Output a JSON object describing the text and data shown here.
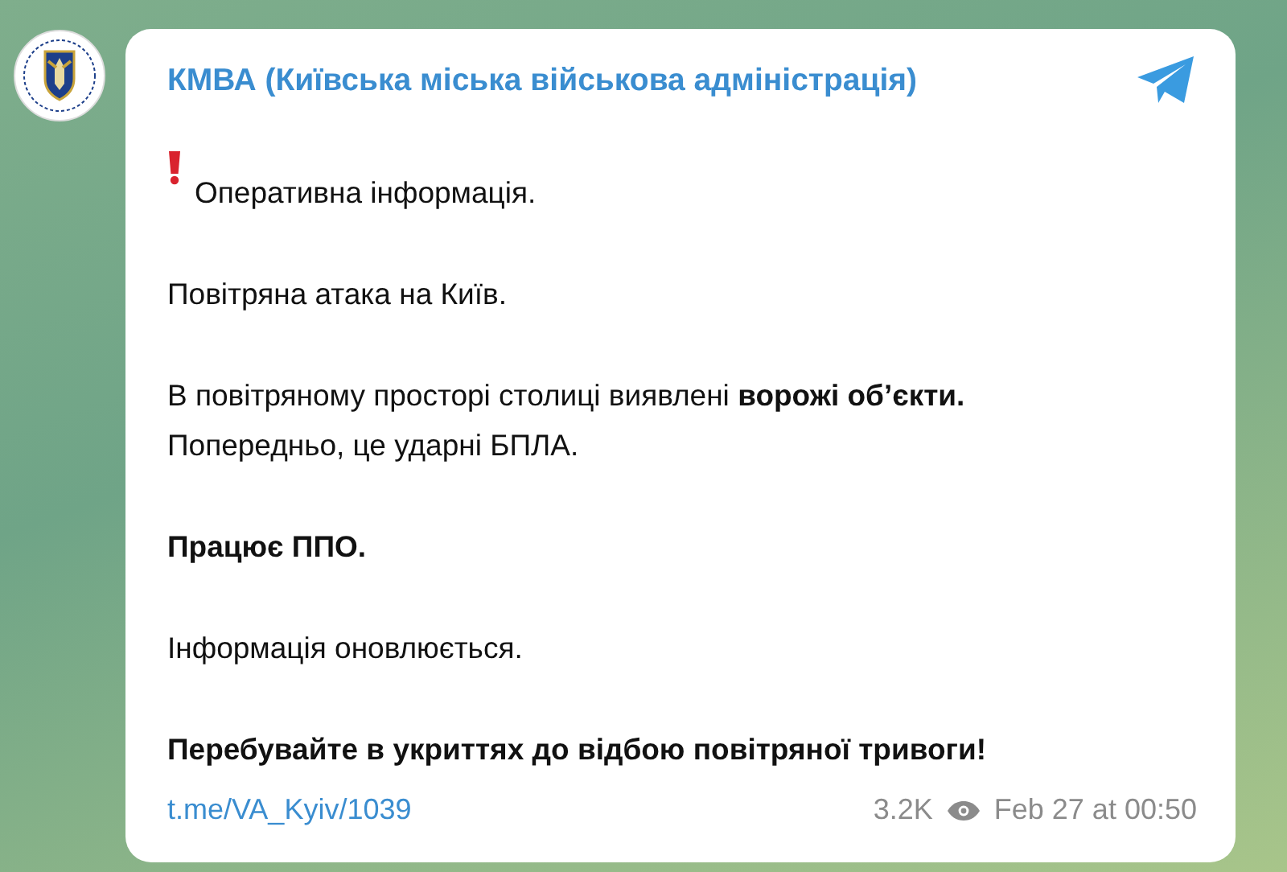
{
  "channel": {
    "name": "КМВА (Київська міська військова адміністрація)"
  },
  "message": {
    "paragraphs": [
      {
        "kind": "alert",
        "text": "Оперативна інформація."
      },
      {
        "kind": "plain",
        "text": "Повітряна атака на Київ."
      },
      {
        "kind": "plain",
        "text": "В повітряному просторі столиці виявлені **ворожі об’єкти.** Попередньо, це ударні БПЛА."
      },
      {
        "kind": "bold",
        "text": "Працює ППО."
      },
      {
        "kind": "plain",
        "text": "Інформація оновлюється."
      },
      {
        "kind": "bold",
        "text": "Перебувайте в укриттях до відбою повітряної тривоги!"
      }
    ],
    "link": "t.me/VA_Kyiv/1039",
    "views": "3.2K",
    "date": "Feb 27 at 00:50"
  }
}
